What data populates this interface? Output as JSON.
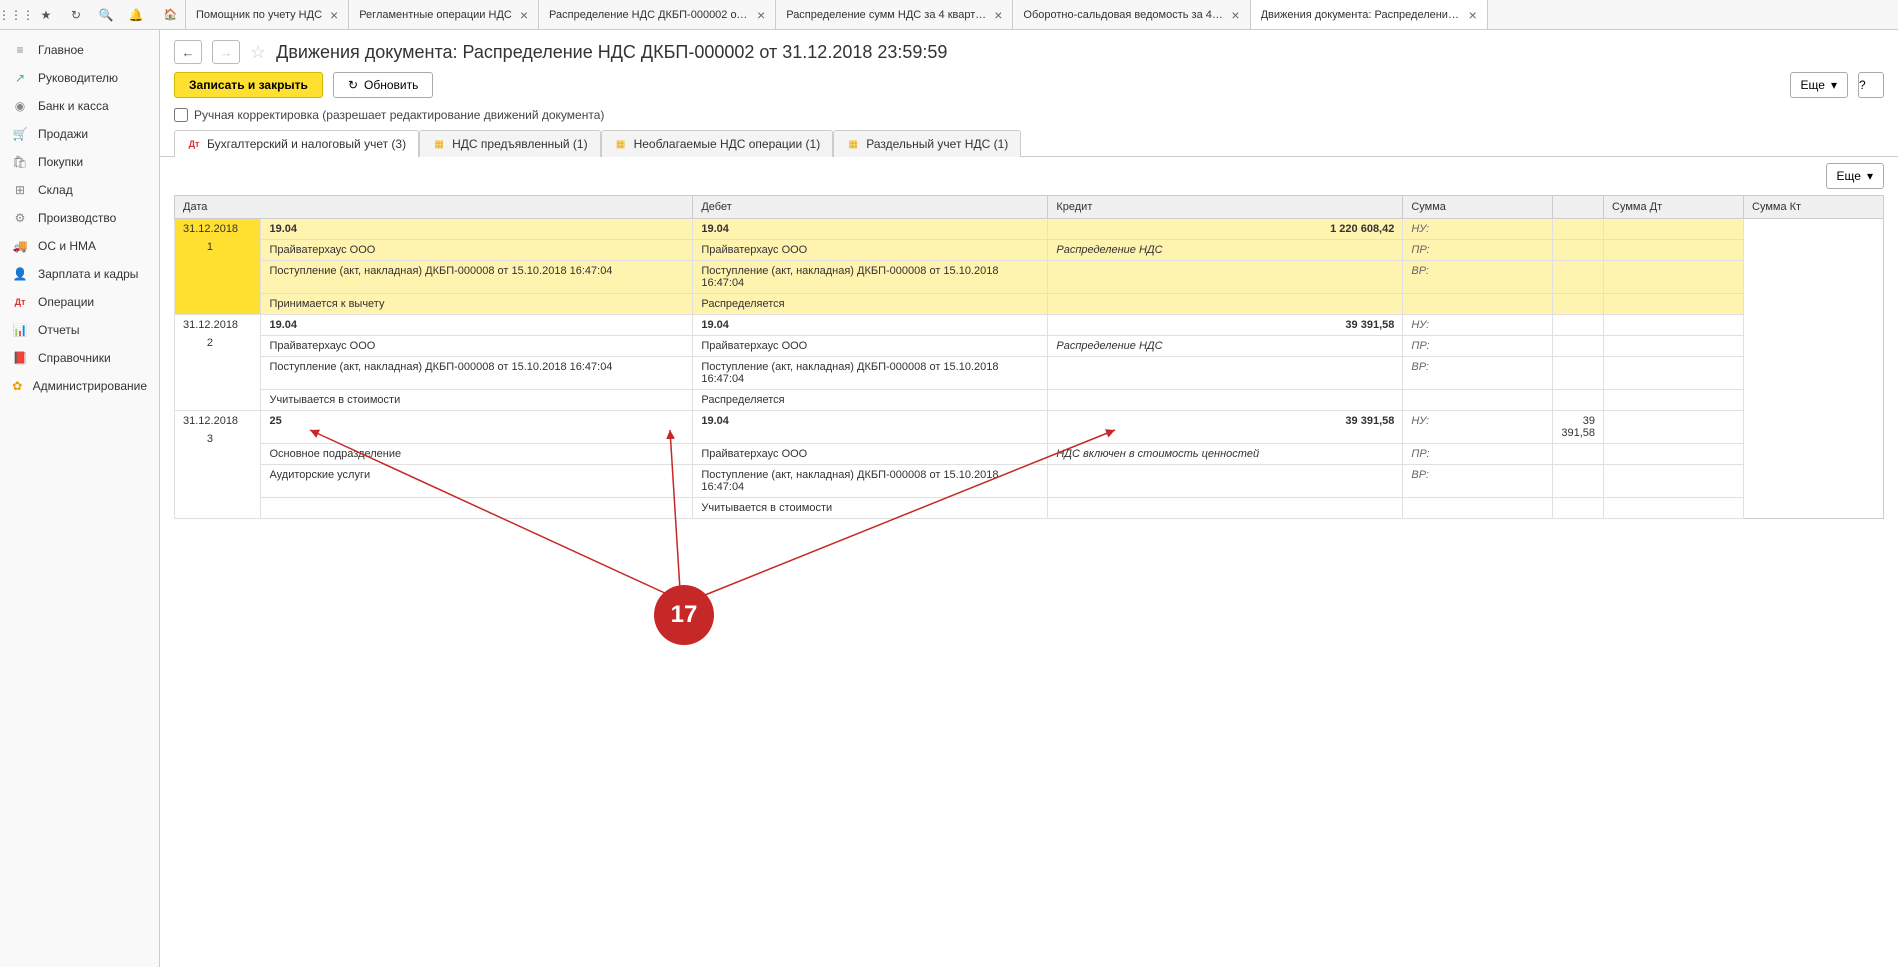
{
  "toolbar_icons": [
    "apps",
    "star",
    "refresh",
    "search",
    "bell"
  ],
  "tabs": [
    {
      "label": "Помощник по учету НДС",
      "closable": true
    },
    {
      "label": "Регламентные операции НДС",
      "closable": true
    },
    {
      "label": "Распределение НДС ДКБП-000002 от 31.12....",
      "closable": true
    },
    {
      "label": "Распределение сумм НДС за 4 квартал 201...",
      "closable": true
    },
    {
      "label": "Оборотно-сальдовая ведомость за 4 кварта...",
      "closable": true
    },
    {
      "label": "Движения документа: Распределение НДС ...",
      "closable": true,
      "active": true
    }
  ],
  "sidebar": [
    {
      "icon": "≡",
      "label": "Главное"
    },
    {
      "icon": "↗",
      "label": "Руководителю",
      "cls": "green"
    },
    {
      "icon": "◉",
      "label": "Банк и касса"
    },
    {
      "icon": "🛒",
      "label": "Продажи"
    },
    {
      "icon": "🛍",
      "label": "Покупки"
    },
    {
      "icon": "⊞",
      "label": "Склад"
    },
    {
      "icon": "⚙",
      "label": "Производство"
    },
    {
      "icon": "🚚",
      "label": "ОС и НМА"
    },
    {
      "icon": "👤",
      "label": "Зарплата и кадры"
    },
    {
      "icon": "Дт",
      "label": "Операции"
    },
    {
      "icon": "📊",
      "label": "Отчеты"
    },
    {
      "icon": "📕",
      "label": "Справочники"
    },
    {
      "icon": "✿",
      "label": "Администрирование",
      "cls": "orange"
    }
  ],
  "page": {
    "title": "Движения документа: Распределение НДС ДКБП-000002 от 31.12.2018 23:59:59",
    "save_close": "Записать и закрыть",
    "refresh": "Обновить",
    "more": "Еще",
    "help": "?",
    "manual_edit": "Ручная корректировка (разрешает редактирование движений документа)"
  },
  "inner_tabs": [
    {
      "label": "Бухгалтерский и налоговый учет (3)",
      "icon": "Дт",
      "active": true
    },
    {
      "label": "НДС предъявленный (1)",
      "icon": "▦"
    },
    {
      "label": "Необлагаемые НДС операции (1)",
      "icon": "▦"
    },
    {
      "label": "Раздельный учет НДС (1)",
      "icon": "▦"
    }
  ],
  "grid": {
    "headers": {
      "date": "Дата",
      "debit": "Дебет",
      "credit": "Кредит",
      "sum": "Сумма",
      "sdt": "Сумма Дт",
      "skt": "Сумма Кт"
    },
    "rows": [
      {
        "hl": true,
        "date": "31.12.2018",
        "num": "1",
        "d_acc": "19.04",
        "c_acc": "19.04",
        "sum": "1 220 608,42",
        "d_sub1": "Прайватерхаус ООО",
        "c_sub1": "Прайватерхаус ООО",
        "sum_lbl": "Распределение НДС",
        "d_sub2": "Поступление (акт, накладная) ДКБП-000008 от 15.10.2018 16:47:04",
        "c_sub2": "Поступление (акт, накладная) ДКБП-000008 от 15.10.2018 16:47:04",
        "d_sub3": "Принимается к вычету",
        "c_sub3": "Распределяется",
        "nu": "НУ:",
        "pr": "ПР:",
        "vr": "ВР:"
      },
      {
        "date": "31.12.2018",
        "num": "2",
        "d_acc": "19.04",
        "c_acc": "19.04",
        "sum": "39 391,58",
        "d_sub1": "Прайватерхаус ООО",
        "c_sub1": "Прайватерхаус ООО",
        "sum_lbl": "Распределение НДС",
        "d_sub2": "Поступление (акт, накладная) ДКБП-000008 от 15.10.2018 16:47:04",
        "c_sub2": "Поступление (акт, накладная) ДКБП-000008 от 15.10.2018 16:47:04",
        "d_sub3": "Учитывается в стоимости",
        "c_sub3": "Распределяется",
        "nu": "НУ:",
        "pr": "ПР:",
        "vr": "ВР:"
      },
      {
        "date": "31.12.2018",
        "num": "3",
        "d_acc": "25",
        "c_acc": "19.04",
        "sum": "39 391,58",
        "d_sub1": "Основное подразделение",
        "c_sub1": "Прайватерхаус ООО",
        "sum_lbl": "НДС включен в стоимость ценностей",
        "d_sub2": "Аудиторские услуги",
        "c_sub2": "Поступление (акт, накладная) ДКБП-000008 от 15.10.2018 16:47:04",
        "d_sub3": "",
        "c_sub3": "Учитывается в стоимости",
        "nu": "НУ:",
        "pr": "ПР:",
        "vr": "ВР:",
        "sdt": "39 391,58"
      }
    ]
  },
  "annotation": {
    "label": "17"
  }
}
